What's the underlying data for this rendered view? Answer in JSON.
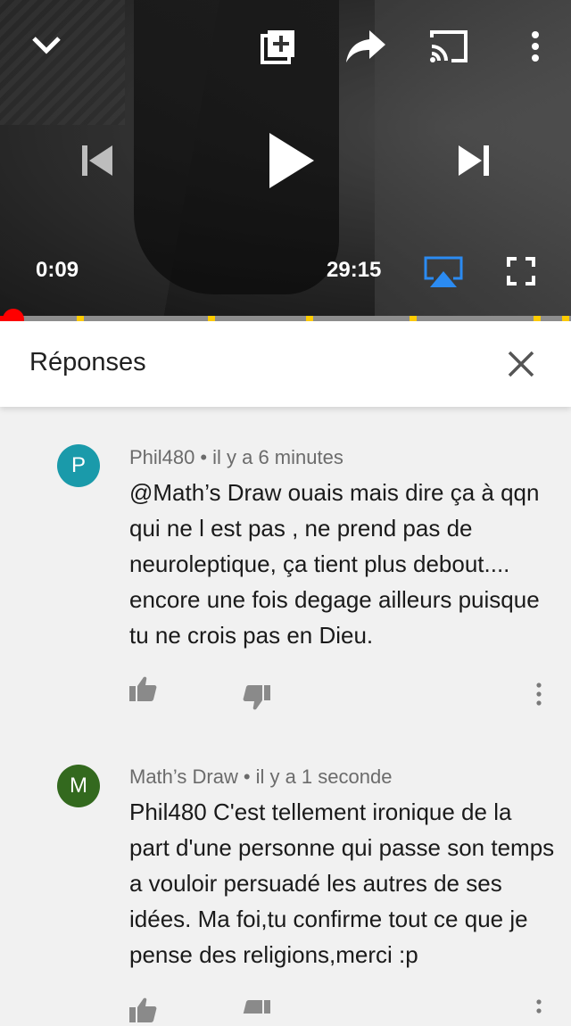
{
  "player": {
    "current_time": "0:09",
    "duration": "29:15",
    "progress_fraction": 0.005,
    "icons": [
      "chevron-down-icon",
      "add-to-playlist-icon",
      "share-icon",
      "cast-icon",
      "more-vert-icon",
      "previous-icon",
      "play-icon",
      "next-icon",
      "airplay-icon",
      "fullscreen-icon"
    ],
    "colors": {
      "scrubber": "#ff0000",
      "chapter_marker": "#ffcc00",
      "airplay": "#2b8bf2"
    }
  },
  "replies": {
    "title": "Réponses"
  },
  "comments": [
    {
      "avatar_letter": "P",
      "avatar_color": "#1a9aaa",
      "author": "Phil480",
      "separator": "•",
      "time": "il y a 6 minutes",
      "text": "@Math’s Draw ouais mais dire ça à qqn qui ne l est pas , ne prend pas de neuroleptique, ça tient plus debout.... encore une fois degage ailleurs puisque tu ne crois pas en Dieu."
    },
    {
      "avatar_letter": "M",
      "avatar_color": "#33691e",
      "author": "Math’s Draw",
      "separator": "•",
      "time": "il y a 1 seconde",
      "text": "Phil480 C'est tellement ironique de la part d'une personne qui passe son temps a vouloir persuadé les autres de ses idées. Ma foi,tu confirme tout ce que je pense des religions,merci :p"
    }
  ]
}
